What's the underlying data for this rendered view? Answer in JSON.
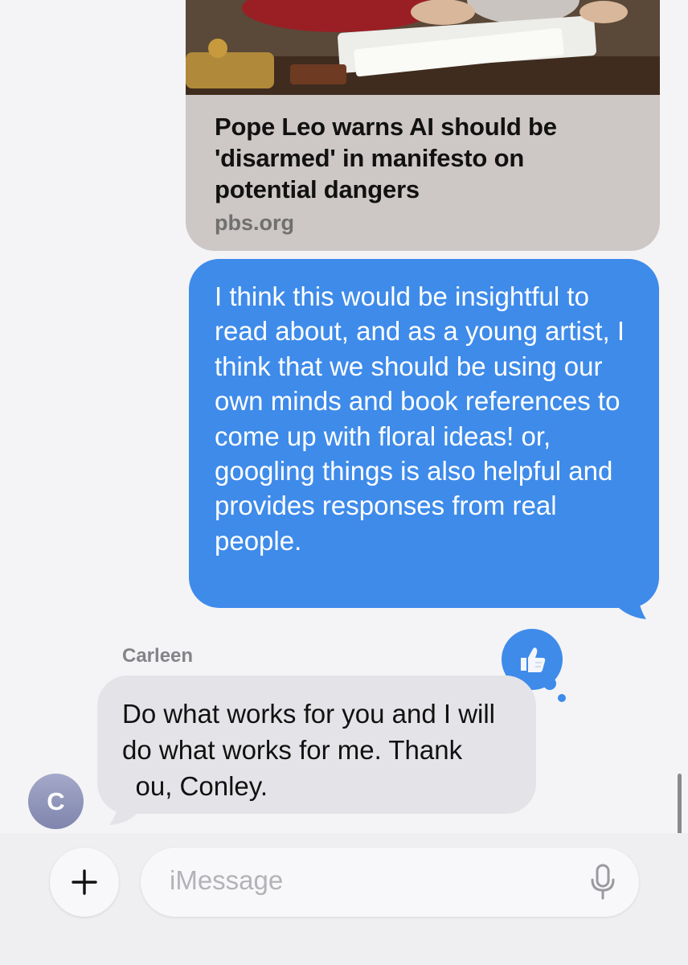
{
  "link_preview": {
    "title": "Pope Leo warns AI should be 'disarmed' in manifesto on potential dangers",
    "domain": "pbs.org"
  },
  "outgoing_message": {
    "text": "I think this would be insightful to read about, and as a young artist, I think that we should be using our own minds and book references to come up with floral ideas! or, googling things is also helpful and provides responses from real people."
  },
  "incoming_message": {
    "sender": "Carleen",
    "text": "Do what works for you and I will do what works for me. Thank you, Conley.",
    "avatar_initial": "C"
  },
  "reaction": {
    "icon": "thumbs-up-icon"
  },
  "composer": {
    "placeholder": "iMessage",
    "add_icon": "plus-icon",
    "mic_icon": "microphone-icon"
  },
  "colors": {
    "outgoing_bubble": "#3e8bea",
    "incoming_bubble": "#e4e4e8",
    "link_card": "#cdc7c5",
    "background": "#f4f4f6"
  }
}
